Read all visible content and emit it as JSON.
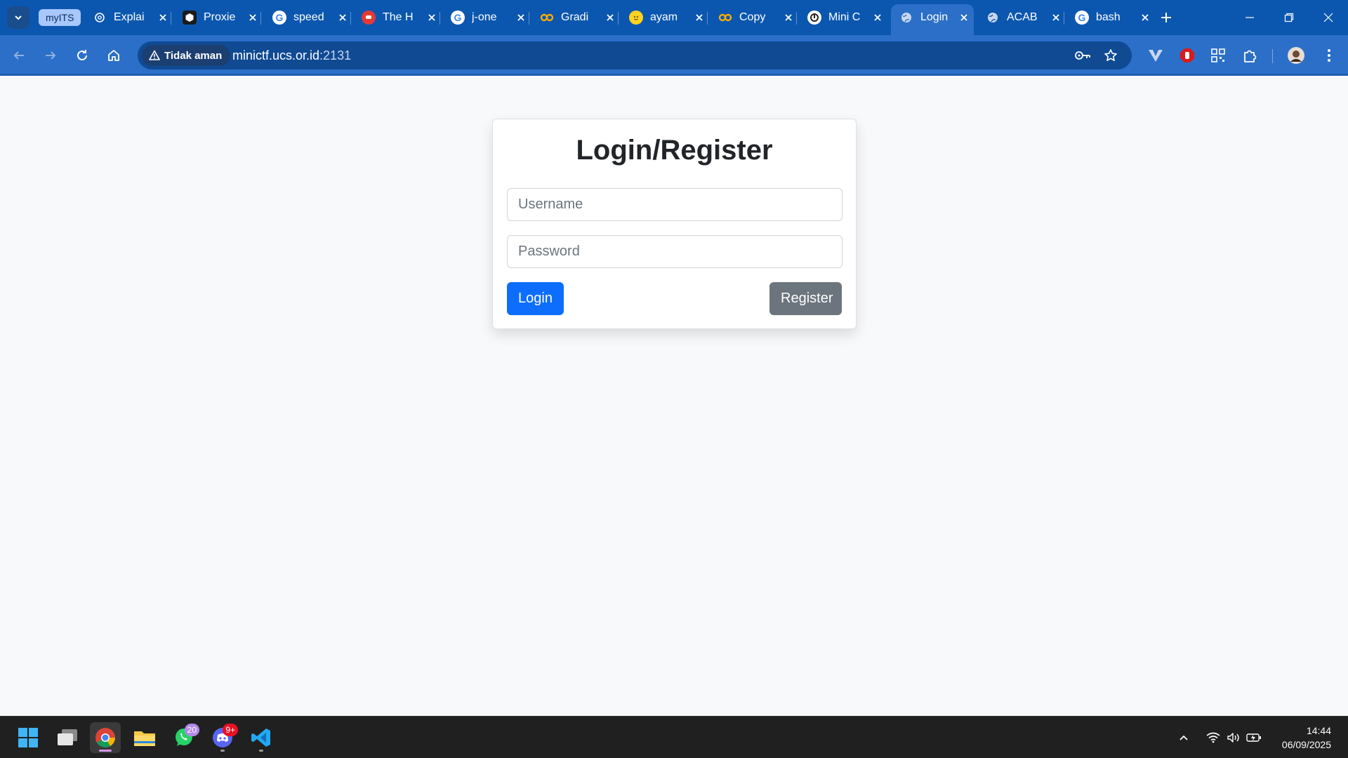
{
  "browser": {
    "tab_group_label": "myITS",
    "tabs": [
      {
        "title": "Explai",
        "icon": "chatgpt-icon",
        "active": false
      },
      {
        "title": "Proxie",
        "icon": "hexagon-icon",
        "active": false
      },
      {
        "title": "speed",
        "icon": "google-icon",
        "active": false
      },
      {
        "title": "The H",
        "icon": "chat-bubble-icon",
        "active": false
      },
      {
        "title": "j-one",
        "icon": "google-icon",
        "active": false
      },
      {
        "title": "Gradi",
        "icon": "colab-icon",
        "active": false
      },
      {
        "title": "ayam",
        "icon": "huggingface-icon",
        "active": false
      },
      {
        "title": "Copy",
        "icon": "colab-icon",
        "active": false
      },
      {
        "title": "Mini C",
        "icon": "ctf-icon",
        "active": false
      },
      {
        "title": "Login",
        "icon": "globe-icon",
        "active": true
      },
      {
        "title": "ACAB",
        "icon": "globe-icon",
        "active": false
      },
      {
        "title": "bash",
        "icon": "google-icon",
        "active": false
      }
    ],
    "security_label": "Tidak aman",
    "url_host": "minictf.ucs.or.id",
    "url_port": ":2131"
  },
  "page": {
    "heading": "Login/Register",
    "username_placeholder": "Username",
    "password_placeholder": "Password",
    "login_label": "Login",
    "register_label": "Register"
  },
  "taskbar": {
    "whatsapp_badge": "20",
    "discord_badge": "9+",
    "time": "14:44",
    "date": "06/09/2025"
  },
  "colors": {
    "browser_frame": "#0b57b0",
    "toolbar": "#2b6fc9",
    "page_background": "#f8f9fa",
    "primary_button": "#0d6efd",
    "secondary_button": "#6c757d"
  }
}
